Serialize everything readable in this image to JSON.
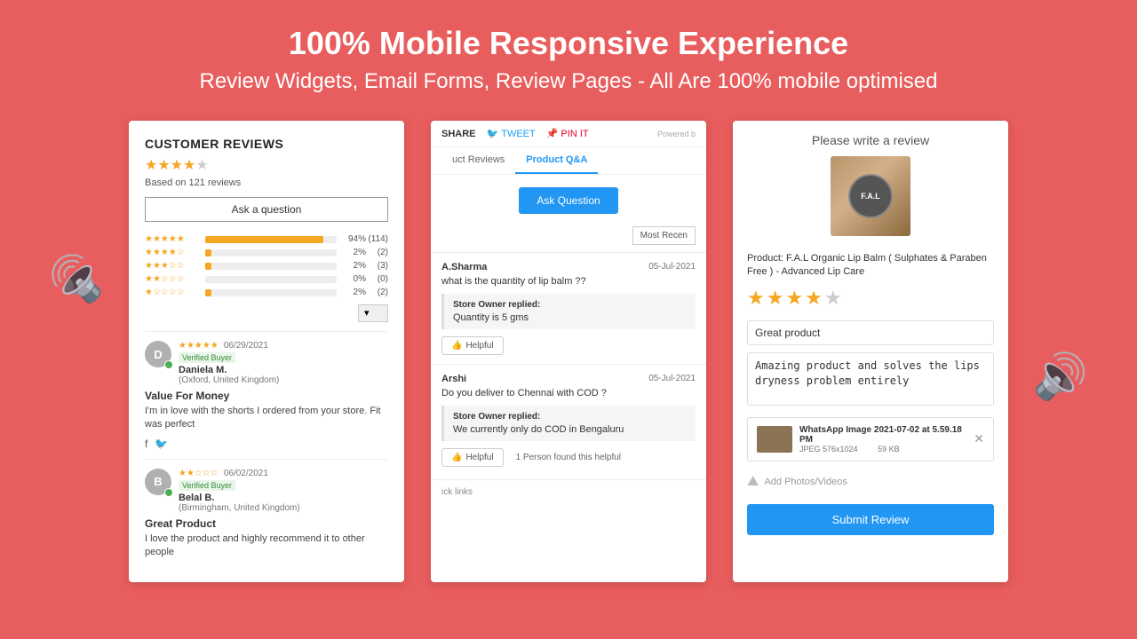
{
  "header": {
    "title": "100% Mobile Responsive Experience",
    "subtitle": "Review Widgets, Email Forms, Review Pages - All Are 100% mobile optimised"
  },
  "wave_left": "🔊",
  "wave_right": "🔊",
  "card1": {
    "title": "CUSTOMER REVIEWS",
    "overall_stars": "★★★★★",
    "based_on": "Based on 121 reviews",
    "ask_btn": "Ask a question",
    "ratings": [
      {
        "stars": "★★★★★",
        "pct": "94%",
        "count": "(114)",
        "bar_width": "90%"
      },
      {
        "stars": "★★★★☆",
        "pct": "2%",
        "count": "(2)",
        "bar_width": "5%"
      },
      {
        "stars": "★★★☆☆",
        "pct": "2%",
        "count": "(3)",
        "bar_width": "5%"
      },
      {
        "stars": "★★☆☆☆",
        "pct": "0%",
        "count": "(0)",
        "bar_width": "0%"
      },
      {
        "stars": "★☆☆☆☆",
        "pct": "2%",
        "count": "(2)",
        "bar_width": "5%"
      }
    ],
    "reviews": [
      {
        "avatar": "D",
        "stars": "★★★★★",
        "date": "06/29/2021",
        "verified": "Verified Buyer",
        "name": "Daniela M.",
        "location": "(Oxford, United Kingdom)",
        "title": "Value For Money",
        "text": "I'm in love with the shorts I ordered from your store. Fit was perfect"
      },
      {
        "avatar": "B",
        "stars": "★★☆☆☆",
        "date": "06/02/2021",
        "verified": "Verified Buyer",
        "name": "Belal B.",
        "location": "(Birmingham, United Kingdom)",
        "title": "Great Product",
        "text": "I love the product and highly recommend it to other people"
      }
    ]
  },
  "card2": {
    "share": "SHARE",
    "tweet": "TWEET",
    "pin": "PIN IT",
    "powered_by": "Powered b",
    "tabs": [
      "uct Reviews",
      "Product Q&A"
    ],
    "active_tab": "Product Q&A",
    "ask_question_btn": "Ask Question",
    "filter": "Most Recen",
    "qa_items": [
      {
        "author": "A.Sharma",
        "date": "05-Jul-2021",
        "question": "what is the quantity of lip balm ??",
        "reply_author": "Store Owner replied:",
        "reply_text": "Quantity is 5 gms",
        "helpful_label": "Helpful",
        "helpful_count": ""
      },
      {
        "author": "Arshi",
        "date": "05-Jul-2021",
        "question": "Do you deliver to Chennai with COD ?",
        "reply_author": "Store Owner replied:",
        "reply_text": "We currently only do COD in Bengaluru",
        "helpful_label": "Helpful",
        "helpful_count": "1 Person found this helpful"
      }
    ]
  },
  "card3": {
    "title": "Please write a review",
    "product_label": "F.A.L",
    "product_name": "Product: F.A.L Organic Lip Balm ( Sulphates & Paraben Free ) - Advanced Lip Care",
    "stars_filled": 4,
    "stars_total": 5,
    "review_title_placeholder": "Great product",
    "review_body": "Amazing product and solves the lips dryness problem entirely",
    "file": {
      "name": "WhatsApp Image 2021-07-02 at 5.59.18 PM",
      "type": "JPEG  576x1024",
      "size": "59 KB"
    },
    "add_photos_label": "Add Photos/Videos",
    "submit_btn": "Submit Review"
  }
}
